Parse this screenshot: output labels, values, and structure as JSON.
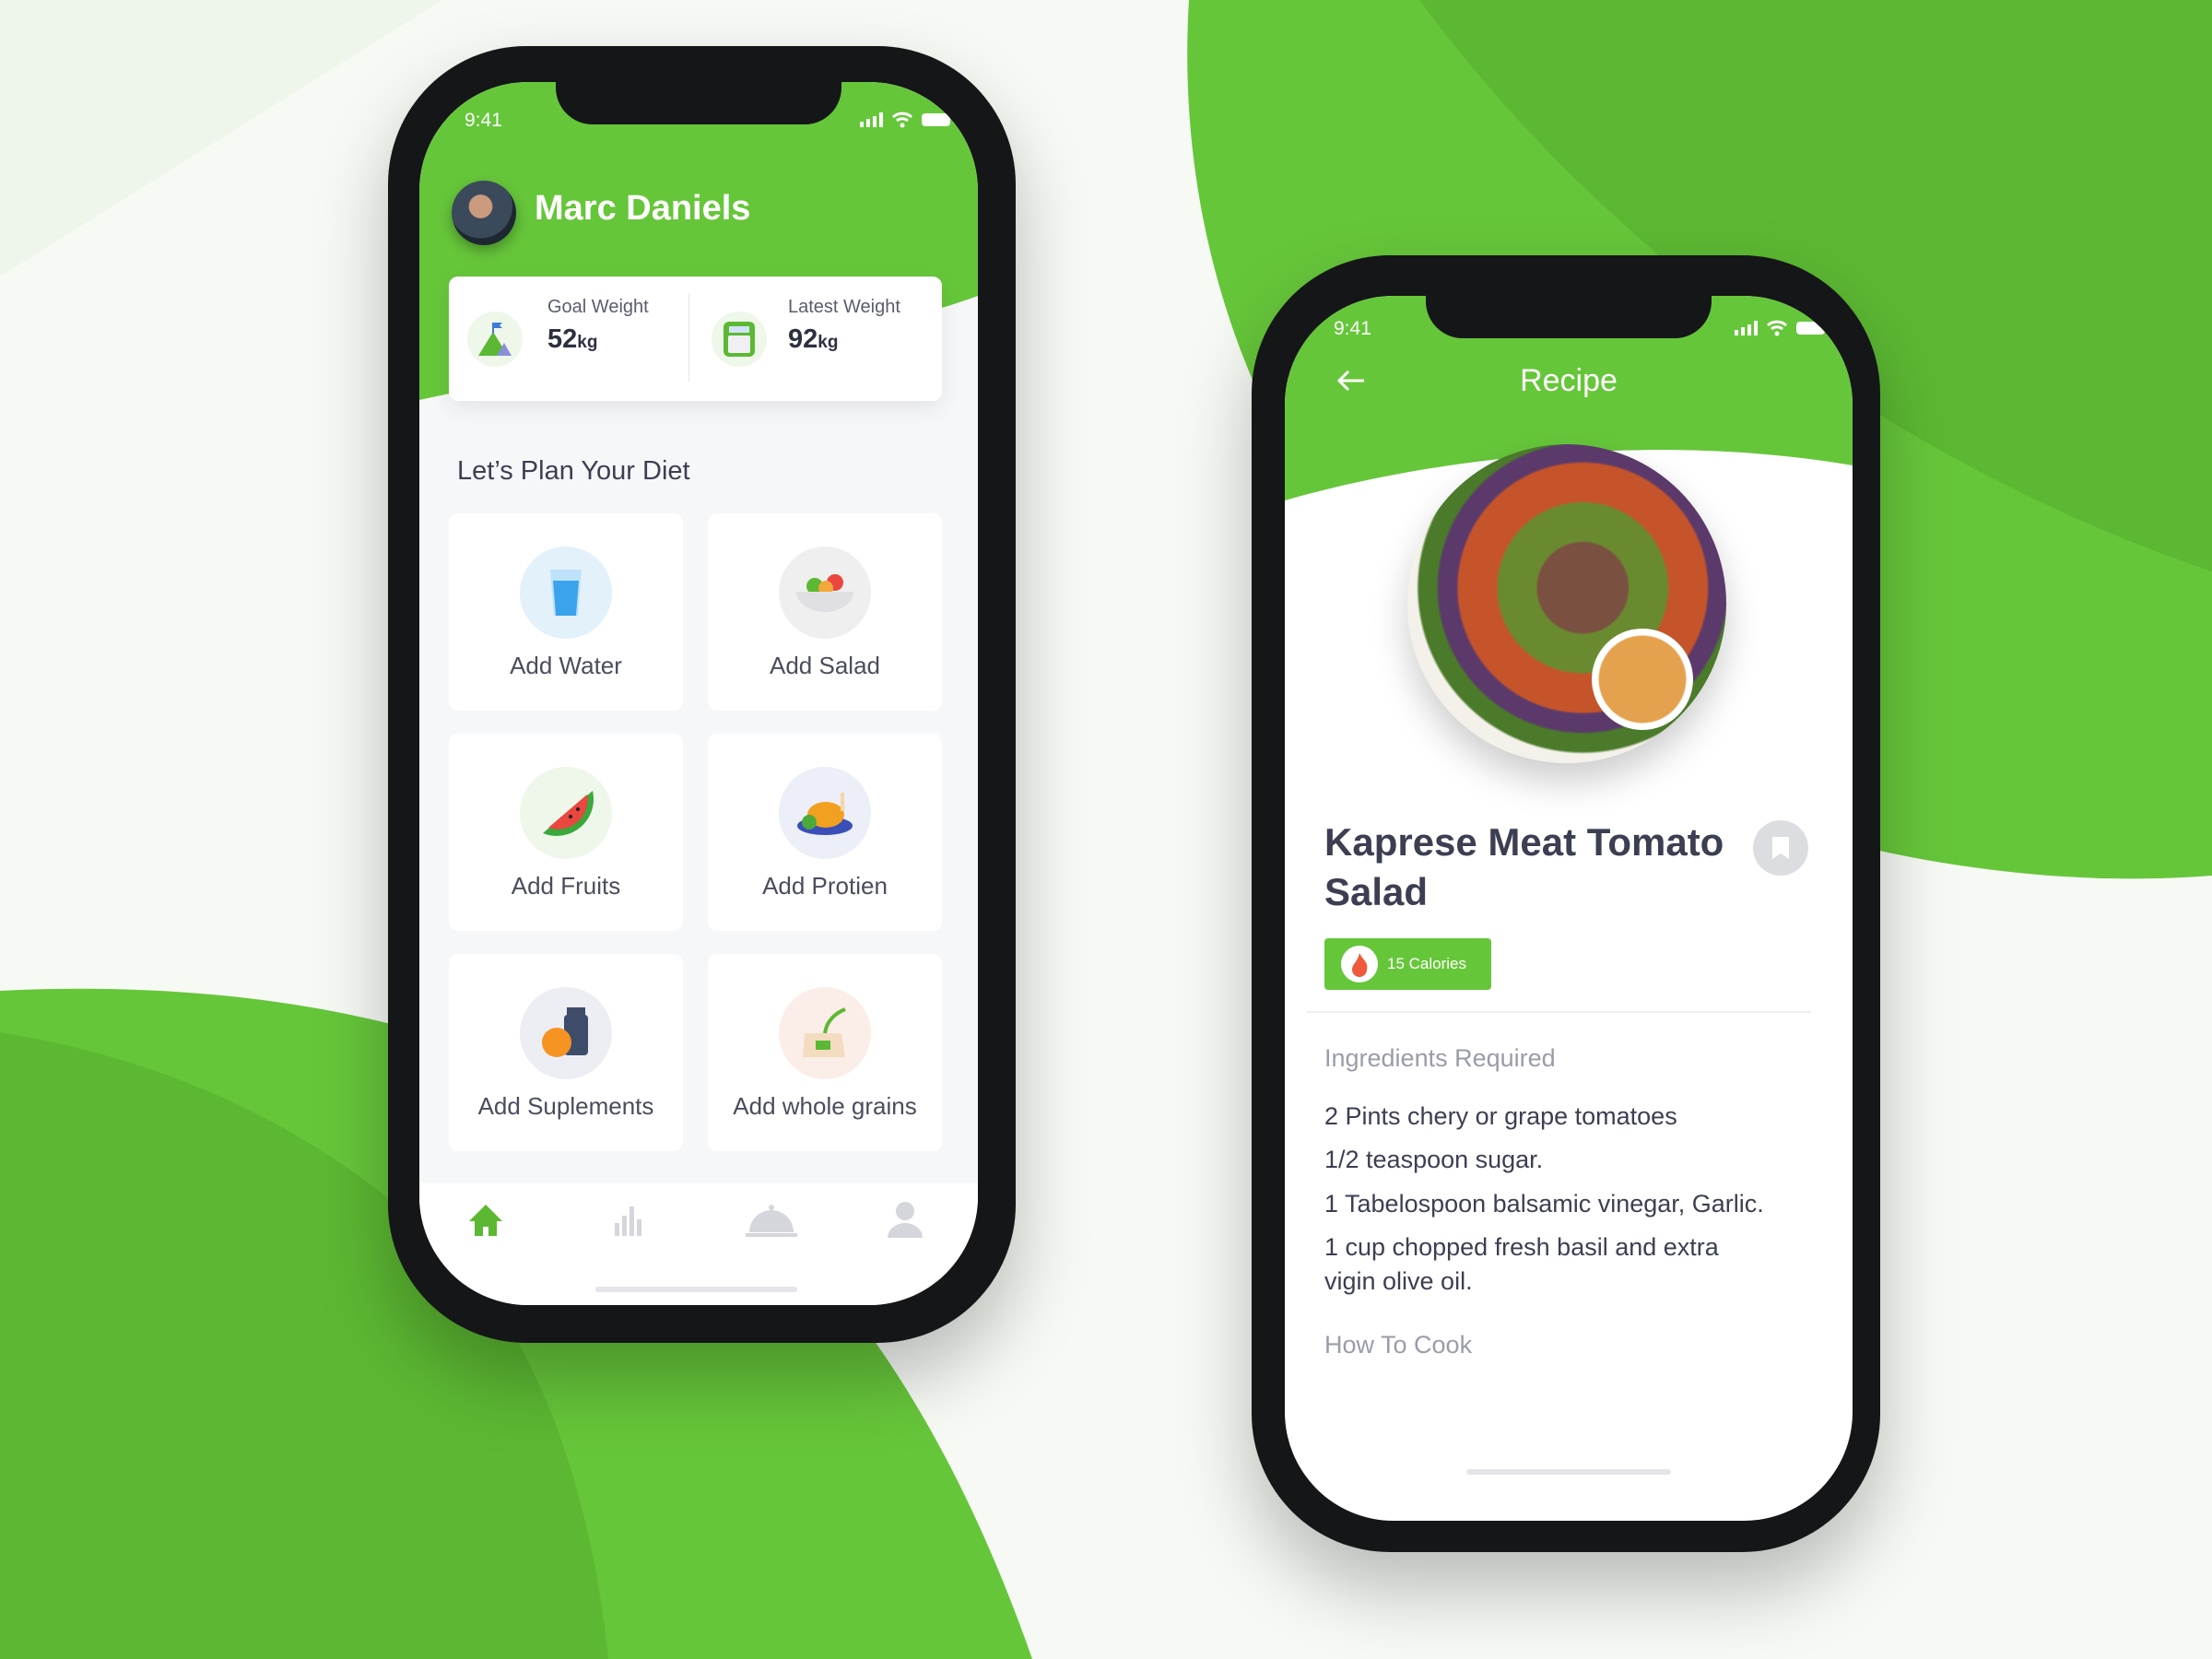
{
  "colors": {
    "brand": "#66c63a",
    "text": "#3c3f52",
    "muted": "#9a9ca8"
  },
  "home": {
    "status_time": "9:41",
    "user_name": "Marc Daniels",
    "stats": [
      {
        "label": "Goal Weight",
        "value": "52",
        "unit": "kg",
        "icon": "mountain-flag-icon"
      },
      {
        "label": "Latest Weight",
        "value": "92",
        "unit": "kg",
        "icon": "scale-icon"
      }
    ],
    "section_title": "Let’s Plan Your Diet",
    "tiles": [
      {
        "label": "Add Water",
        "icon": "water-glass-icon"
      },
      {
        "label": "Add Salad",
        "icon": "salad-bowl-icon"
      },
      {
        "label": "Add Fruits",
        "icon": "watermelon-icon"
      },
      {
        "label": "Add Protien",
        "icon": "chicken-icon"
      },
      {
        "label": "Add Suplements",
        "icon": "supplement-icon"
      },
      {
        "label": "Add whole grains",
        "icon": "grain-sack-icon"
      }
    ],
    "tabbar": [
      "home-icon",
      "chart-icon",
      "cloche-icon",
      "profile-icon"
    ],
    "active_tab": "home"
  },
  "recipe": {
    "status_time": "9:41",
    "header_title": "Recipe",
    "title_line1": "Kaprese Meat Tomato",
    "title_line2": "Salad",
    "calories": "15 Calories",
    "ingredients_title": "Ingredients Required",
    "ingredients": [
      "2 Pints chery or grape tomatoes",
      "1/2 teaspoon sugar.",
      "1 Tabelospoon balsamic vinegar, Garlic.",
      "1 cup chopped fresh basil and extra vigin olive oil."
    ],
    "how_to_cook": "How To Cook"
  }
}
